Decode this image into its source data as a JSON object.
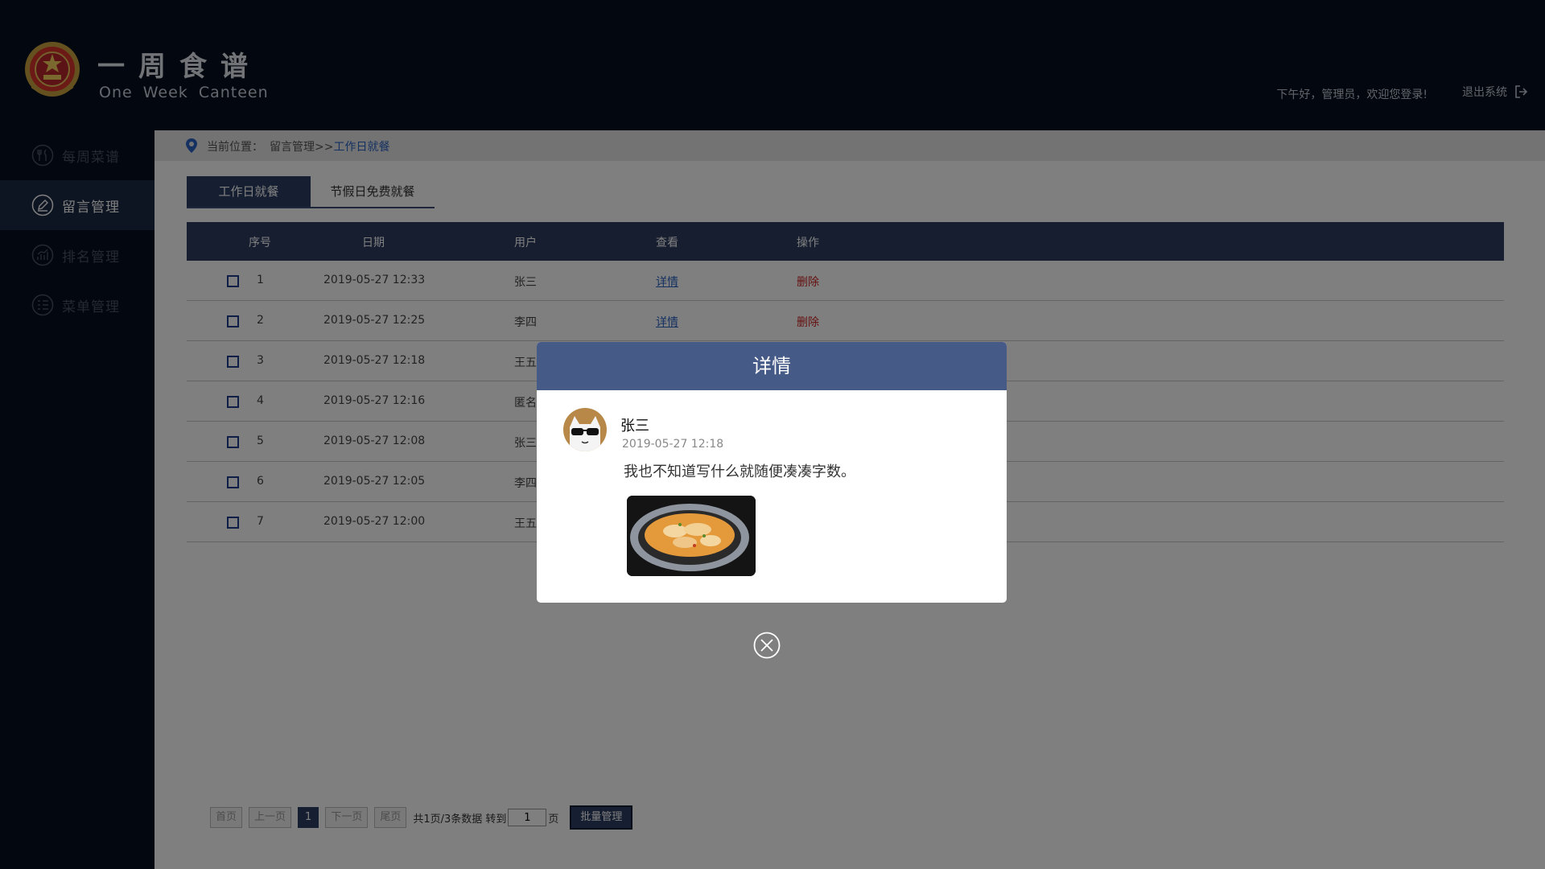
{
  "header": {
    "brand_cn": "一周食谱",
    "brand_en": "One Week Canteen",
    "greeting": "下午好，管理员，欢迎您登录!",
    "logout_label": "退出系统"
  },
  "sidebar": {
    "items": [
      {
        "label": "每周菜谱",
        "icon": "fork-knife-icon",
        "active": false
      },
      {
        "label": "留言管理",
        "icon": "pencil-icon",
        "active": true
      },
      {
        "label": "排名管理",
        "icon": "bar-chart-icon",
        "active": false
      },
      {
        "label": "菜单管理",
        "icon": "menu-list-icon",
        "active": false
      }
    ]
  },
  "breadcrumb": {
    "prefix": "当前位置：",
    "path": "留言管理>>",
    "current": "工作日就餐"
  },
  "tabs": [
    {
      "label": "工作日就餐",
      "active": true
    },
    {
      "label": "节假日免费就餐",
      "active": false
    }
  ],
  "table": {
    "headers": {
      "index": "序号",
      "date": "日期",
      "user": "用户",
      "view": "查看",
      "action": "操作"
    },
    "rows": [
      {
        "index": "1",
        "date": "2019-05-27  12:33",
        "user": "张三",
        "view": "详情",
        "action": "删除"
      },
      {
        "index": "2",
        "date": "2019-05-27  12:25",
        "user": "李四",
        "view": "详情",
        "action": "删除"
      },
      {
        "index": "3",
        "date": "2019-05-27  12:18",
        "user": "王五"
      },
      {
        "index": "4",
        "date": "2019-05-27  12:16",
        "user": "匿名"
      },
      {
        "index": "5",
        "date": "2019-05-27  12:08",
        "user": "张三"
      },
      {
        "index": "6",
        "date": "2019-05-27  12:05",
        "user": "李四"
      },
      {
        "index": "7",
        "date": "2019-05-27  12:00",
        "user": "王五"
      }
    ]
  },
  "pagination": {
    "first": "首页",
    "prev": "上一页",
    "current_page": "1",
    "next": "下一页",
    "last": "尾页",
    "summary": "共1页/3条数据 转到",
    "jump_value": "1",
    "page_unit": "页",
    "batch_label": "批量管理"
  },
  "modal": {
    "title": "详情",
    "commenter": "张三",
    "time": "2019-05-27  12:18",
    "text": "我也不知道写什么就随便凑凑字数。",
    "image": "food-dish-photo"
  },
  "colors": {
    "page_bg": "#071020",
    "accent": "#2c3e63",
    "modal_header": "#455a86",
    "link": "#2b62c4",
    "delete": "#cc2222"
  }
}
